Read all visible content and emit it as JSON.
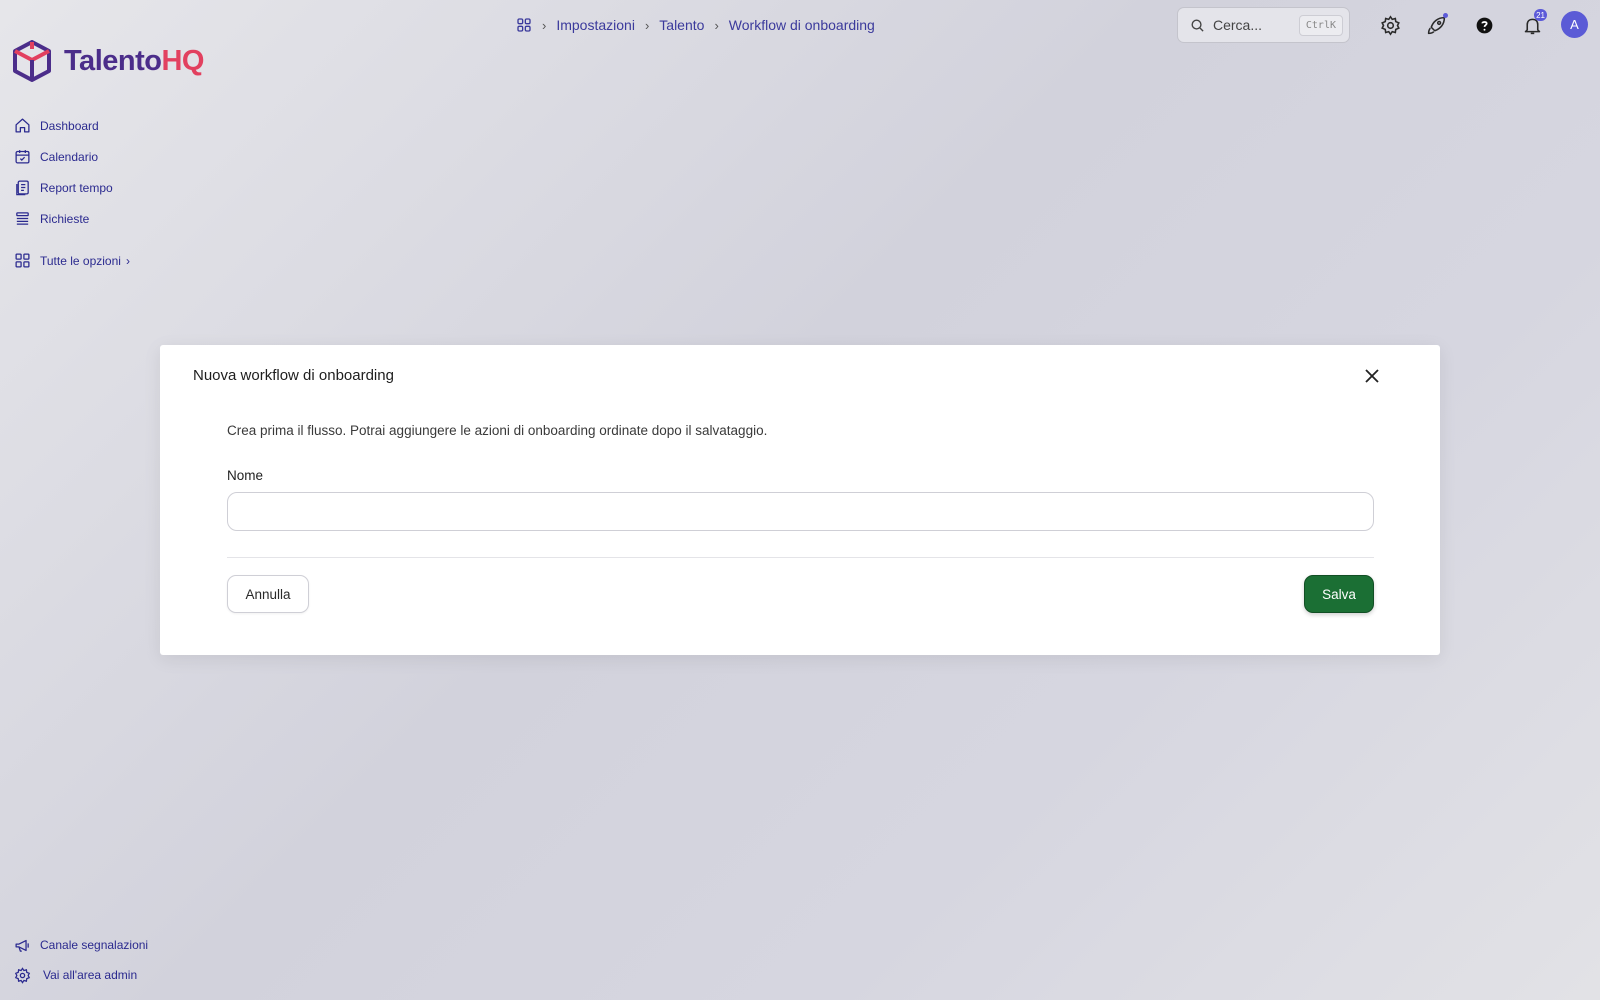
{
  "brand": {
    "name_part1": "Talento",
    "name_part2": "HQ"
  },
  "sidebar": {
    "items": [
      {
        "label": "Dashboard",
        "icon": "home-icon"
      },
      {
        "label": "Calendario",
        "icon": "calendar-icon"
      },
      {
        "label": "Report tempo",
        "icon": "report-icon"
      },
      {
        "label": "Richieste",
        "icon": "list-icon"
      }
    ],
    "all_options": {
      "label": "Tutte le opzioni",
      "icon": "grid-icon"
    },
    "bottom": [
      {
        "label": "Canale segnalazioni",
        "icon": "megaphone-icon"
      },
      {
        "label": "Vai all'area admin",
        "icon": "gear-icon"
      }
    ]
  },
  "breadcrumb": [
    "Impostazioni",
    "Talento",
    "Workflow di onboarding"
  ],
  "search": {
    "placeholder": "Cerca...",
    "shortcut": "CtrlK"
  },
  "notifications": {
    "count": "21"
  },
  "user": {
    "initial": "A"
  },
  "modal": {
    "title": "Nuova workflow di onboarding",
    "description": "Crea prima il flusso. Potrai aggiungere le azioni di onboarding ordinate dopo il salvataggio.",
    "name_label": "Nome",
    "name_value": "",
    "cancel_label": "Annulla",
    "save_label": "Salva"
  },
  "colors": {
    "accent": "#2b2a8f",
    "save_button": "#1b6f34",
    "brand_primary": "#4b2d8a",
    "brand_secondary": "#e2405f",
    "avatar": "#5b5bd6"
  }
}
